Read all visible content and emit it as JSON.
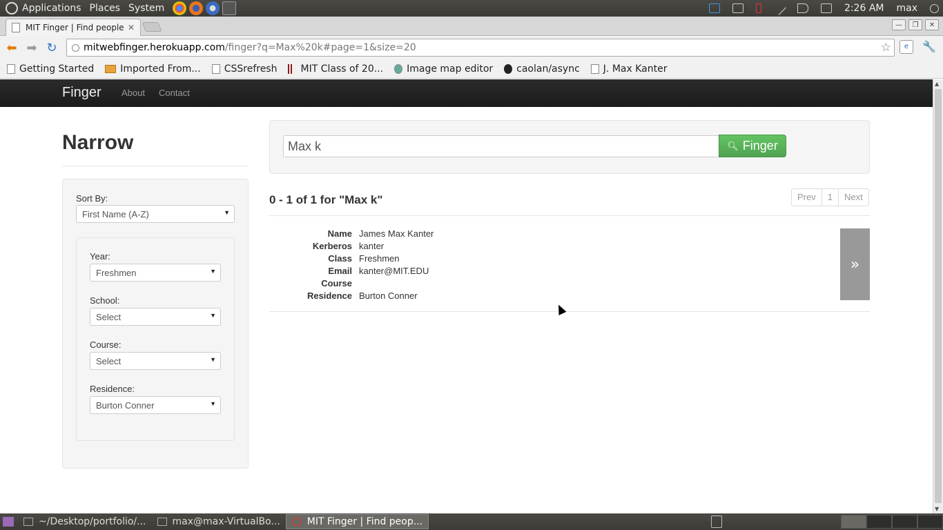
{
  "top_panel": {
    "menus": [
      "Applications",
      "Places",
      "System"
    ],
    "clock": "2:26 AM",
    "user": "max"
  },
  "browser": {
    "tab_title": "MIT Finger | Find people a",
    "url_host": "mitwebfinger.herokuapp.com",
    "url_path": "/finger?q=Max%20k#page=1&size=20",
    "bookmarks": [
      "Getting Started",
      "Imported From...",
      "CSSrefresh",
      "MIT Class of 20...",
      "Image map editor",
      "caolan/async",
      "J. Max Kanter"
    ]
  },
  "navbar": {
    "brand": "Finger",
    "links": [
      "About",
      "Contact"
    ]
  },
  "sidebar": {
    "title": "Narrow",
    "sort_label": "Sort By:",
    "sort_value": "First Name (A-Z)",
    "filters": [
      {
        "label": "Year:",
        "value": "Freshmen"
      },
      {
        "label": "School:",
        "value": "Select"
      },
      {
        "label": "Course:",
        "value": "Select"
      },
      {
        "label": "Residence:",
        "value": "Burton Conner"
      }
    ]
  },
  "search": {
    "query": "Max k",
    "button_label": "Finger"
  },
  "results": {
    "heading": "0 - 1 of 1 for \"Max k\"",
    "pagination": [
      "Prev",
      "1",
      "Next"
    ],
    "items": [
      {
        "fields": [
          {
            "label": "Name",
            "value": "James Max Kanter"
          },
          {
            "label": "Kerberos",
            "value": "kanter"
          },
          {
            "label": "Class",
            "value": "Freshmen"
          },
          {
            "label": "Email",
            "value": "kanter@MIT.EDU"
          },
          {
            "label": "Course",
            "value": ""
          },
          {
            "label": "Residence",
            "value": "Burton Conner"
          }
        ],
        "more_label": "»"
      }
    ]
  },
  "taskbar": {
    "tasks": [
      "~/Desktop/portfolio/...",
      "max@max-VirtualBo...",
      "MIT Finger | Find peop..."
    ]
  },
  "colors": {
    "success": "#5bb75b",
    "navbar": "#1b1b1b"
  }
}
